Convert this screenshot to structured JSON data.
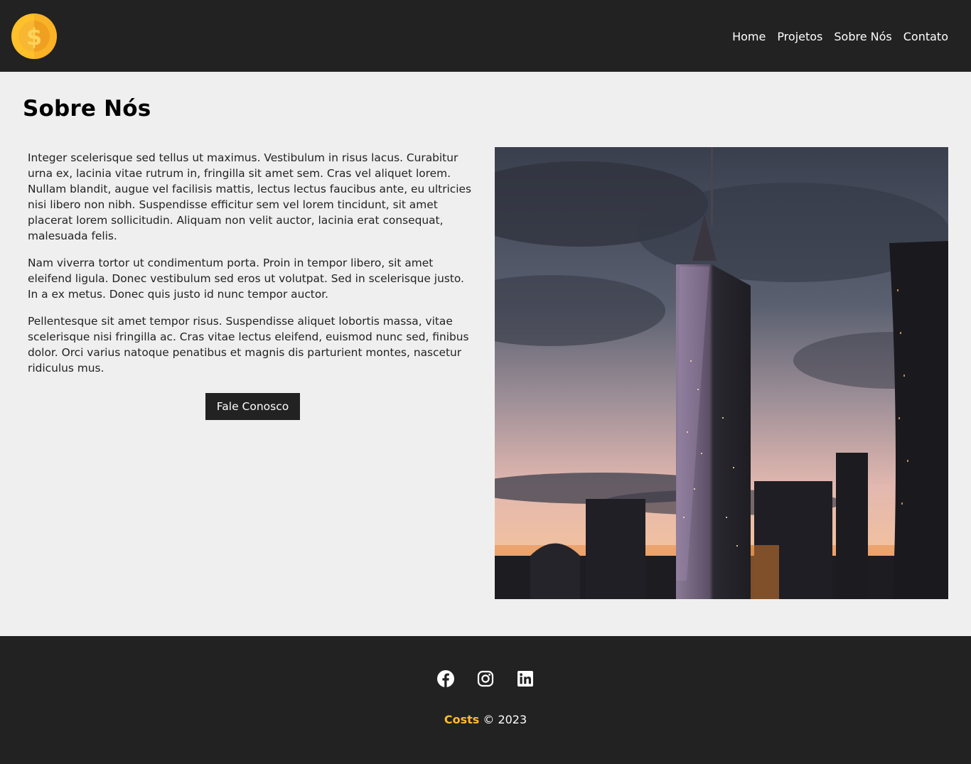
{
  "navbar": {
    "logo_icon": "coin-dollar-icon",
    "links": [
      {
        "label": "Home"
      },
      {
        "label": "Projetos"
      },
      {
        "label": "Sobre Nós"
      },
      {
        "label": "Contato"
      }
    ]
  },
  "main": {
    "title": "Sobre Nós",
    "paragraphs": [
      "Integer scelerisque sed tellus ut maximus. Vestibulum in risus lacus. Curabitur urna ex, lacinia vitae rutrum in, fringilla sit amet sem. Cras vel aliquet lorem. Nullam blandit, augue vel facilisis mattis, lectus lectus faucibus ante, eu ultricies nisi libero non nibh. Suspendisse efficitur sem vel lorem tincidunt, sit amet placerat lorem sollicitudin. Aliquam non velit auctor, lacinia erat consequat, malesuada felis.",
      "Nam viverra tortor ut condimentum porta. Proin in tempor libero, sit amet eleifend ligula. Donec vestibulum sed eros ut volutpat. Sed in scelerisque justo. In a ex metus. Donec quis justo id nunc tempor auctor.",
      "Pellentesque sit amet tempor risus. Suspendisse aliquet lobortis massa, vitae scelerisque nisi fringilla ac. Cras vitae lectus eleifend, euismod nunc sed, finibus dolor. Orci varius natoque penatibus et magnis dis parturient montes, nascetur ridiculus mus."
    ],
    "button_label": "Fale Conosco",
    "image_icon": "city-skyline-photo"
  },
  "footer": {
    "social": [
      "facebook-icon",
      "instagram-icon",
      "linkedin-icon"
    ],
    "brand": "Costs",
    "copyright": "© 2023"
  },
  "colors": {
    "dark": "#222222",
    "background": "#efefef",
    "accent": "#ffbb33"
  }
}
